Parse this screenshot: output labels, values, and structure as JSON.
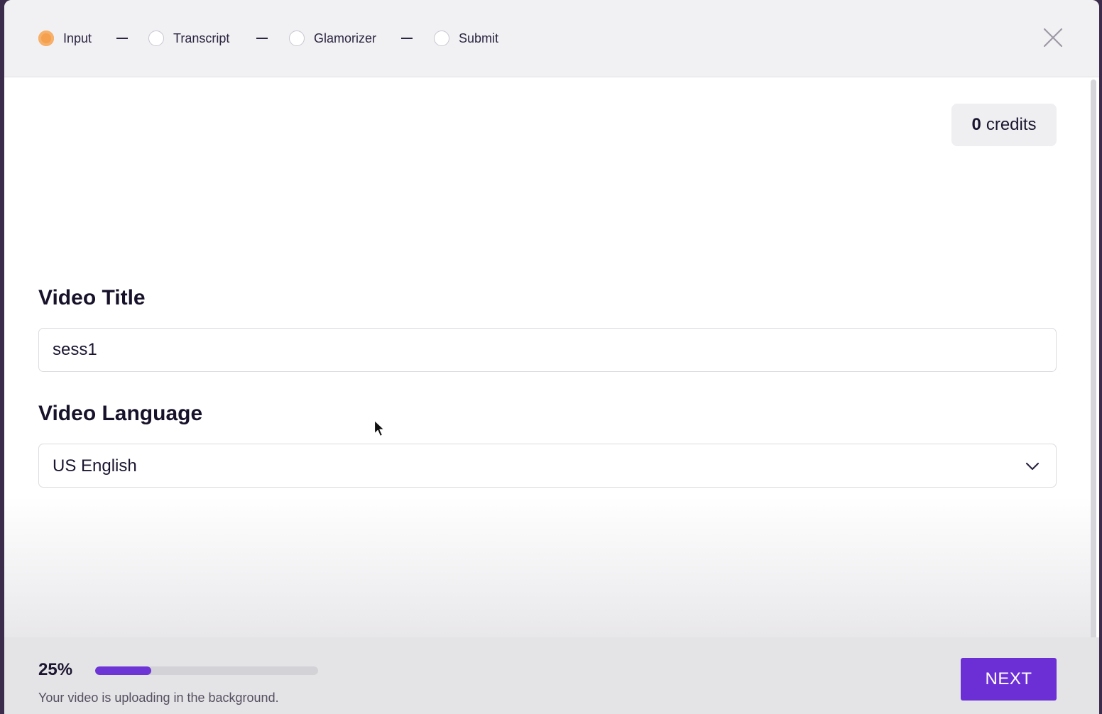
{
  "stepper": {
    "steps": [
      {
        "label": "Input",
        "state": "active"
      },
      {
        "label": "Transcript",
        "state": "pending"
      },
      {
        "label": "Glamorizer",
        "state": "pending"
      },
      {
        "label": "Submit",
        "state": "pending"
      }
    ]
  },
  "credits": {
    "count": "0",
    "unit": "credits"
  },
  "form": {
    "title_label": "Video Title",
    "title_value": "sess1",
    "language_label": "Video Language",
    "language_value": "US English"
  },
  "footer": {
    "progress_text": "25%",
    "progress_fraction": 0.25,
    "upload_note": "Your video is uploading in the background.",
    "next_label": "NEXT"
  },
  "colors": {
    "accent": "#6c2fd6",
    "active_step": "#f4a04e"
  },
  "icons": {
    "close": "close-icon",
    "dropdown": "chevron-down-icon",
    "cursor": "mouse-pointer-icon"
  }
}
